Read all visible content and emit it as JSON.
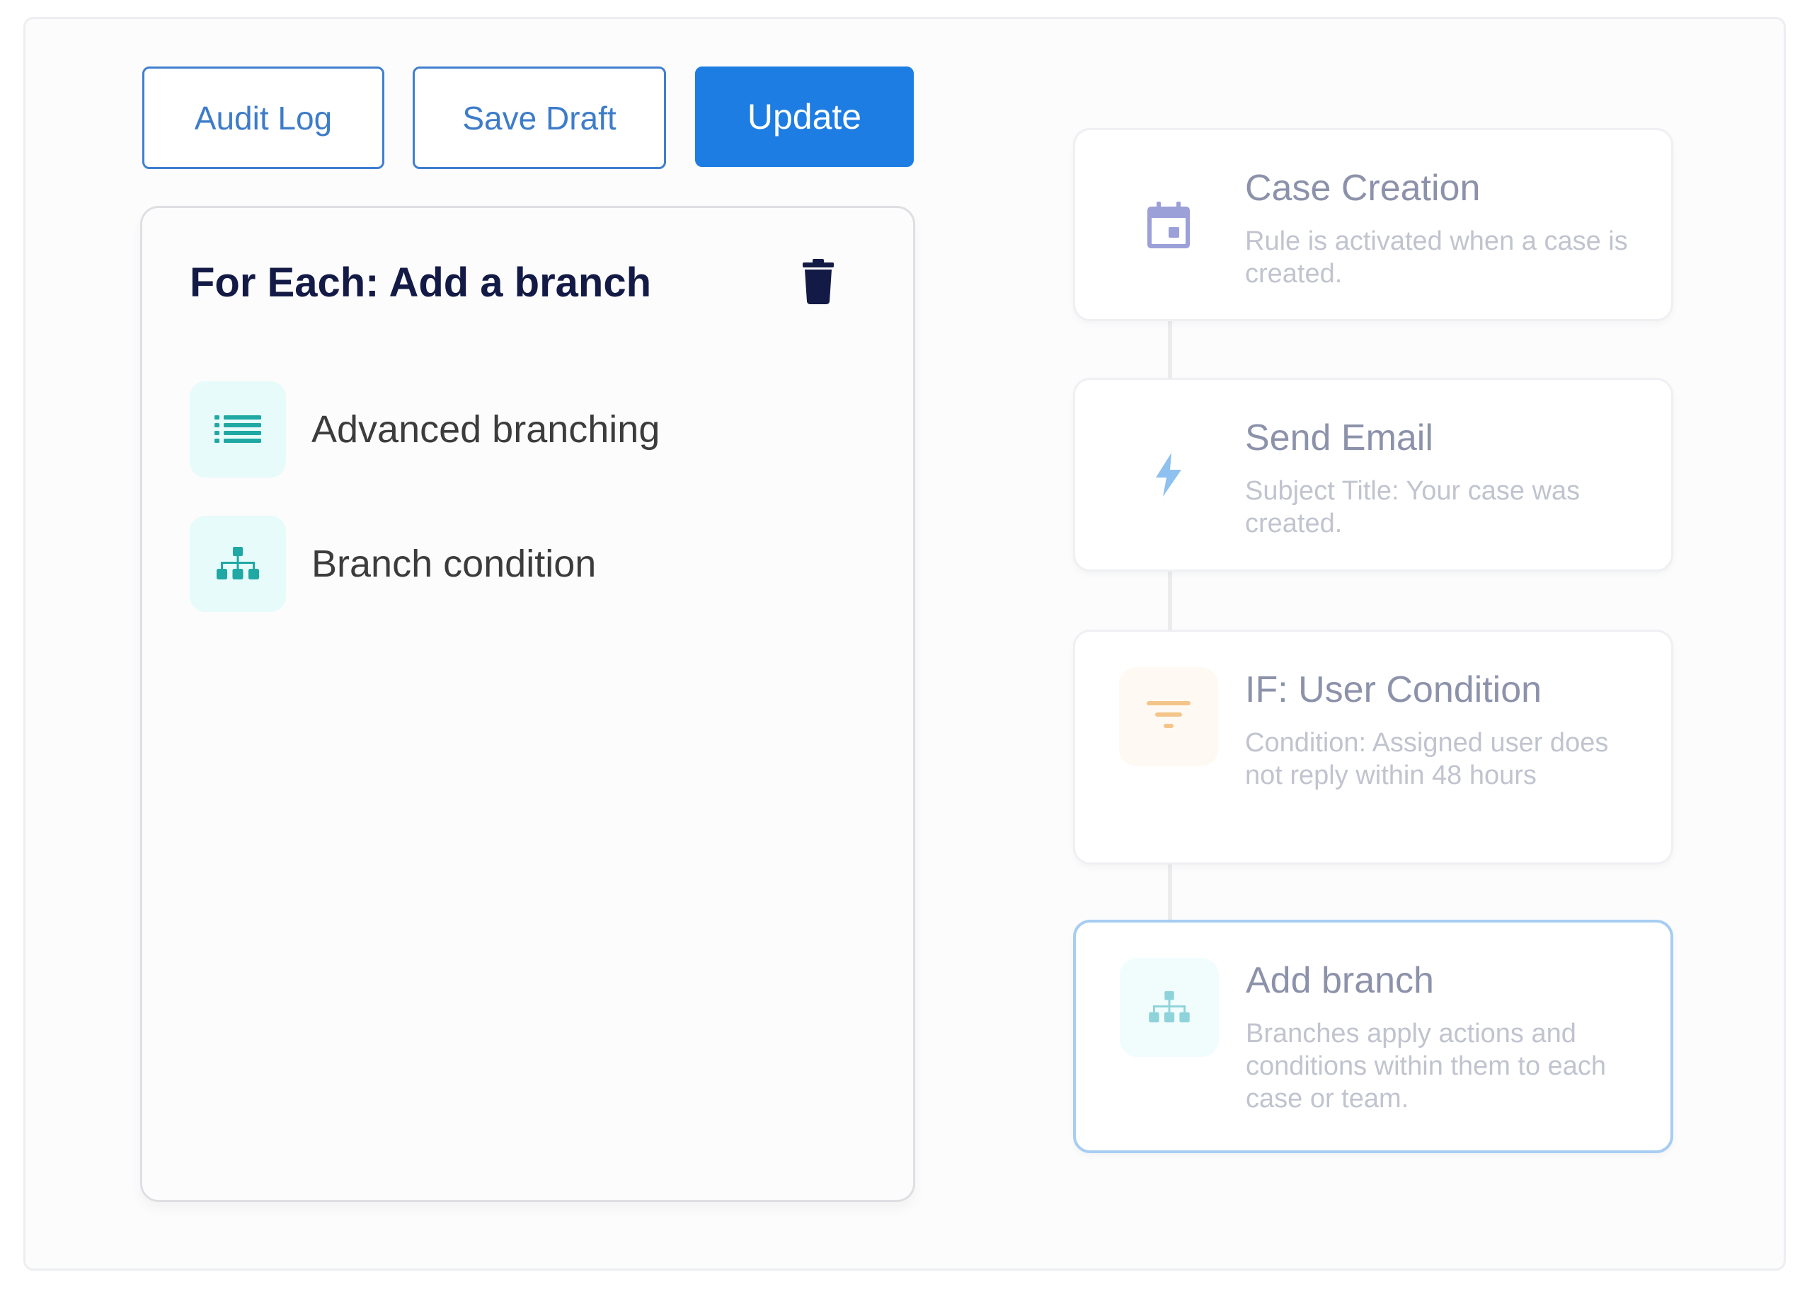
{
  "toolbar": {
    "audit_log_label": "Audit Log",
    "save_draft_label": "Save Draft",
    "update_label": "Update"
  },
  "panel": {
    "title": "For Each: Add a branch",
    "delete_icon": "trash-icon",
    "options": [
      {
        "label": "Advanced branching",
        "icon": "list-icon"
      },
      {
        "label": "Branch condition",
        "icon": "sitemap-icon"
      }
    ]
  },
  "flow": {
    "steps": [
      {
        "title": "Case Creation",
        "description": "Rule is activated when a case is created.",
        "icon": "calendar-icon"
      },
      {
        "title": "Send Email",
        "description": "Subject Title: Your case was created.",
        "icon": "lightning-icon"
      },
      {
        "title": "IF: User Condition",
        "description": "Condition: Assigned user does not reply within 48 hours",
        "icon": "filter-icon"
      },
      {
        "title": "Add branch",
        "description": "Branches apply actions and conditions within them to each case or team.",
        "icon": "sitemap-icon"
      }
    ]
  },
  "colors": {
    "primary": "#1d7de3",
    "outline": "#3f7fcf",
    "title_dark": "#121a45",
    "teal": "#1fa8a4",
    "calendar": "#9ba0d8",
    "lightning": "#8ec1ef",
    "filter": "#f4c58a",
    "selected_border": "#a8cdf2"
  }
}
